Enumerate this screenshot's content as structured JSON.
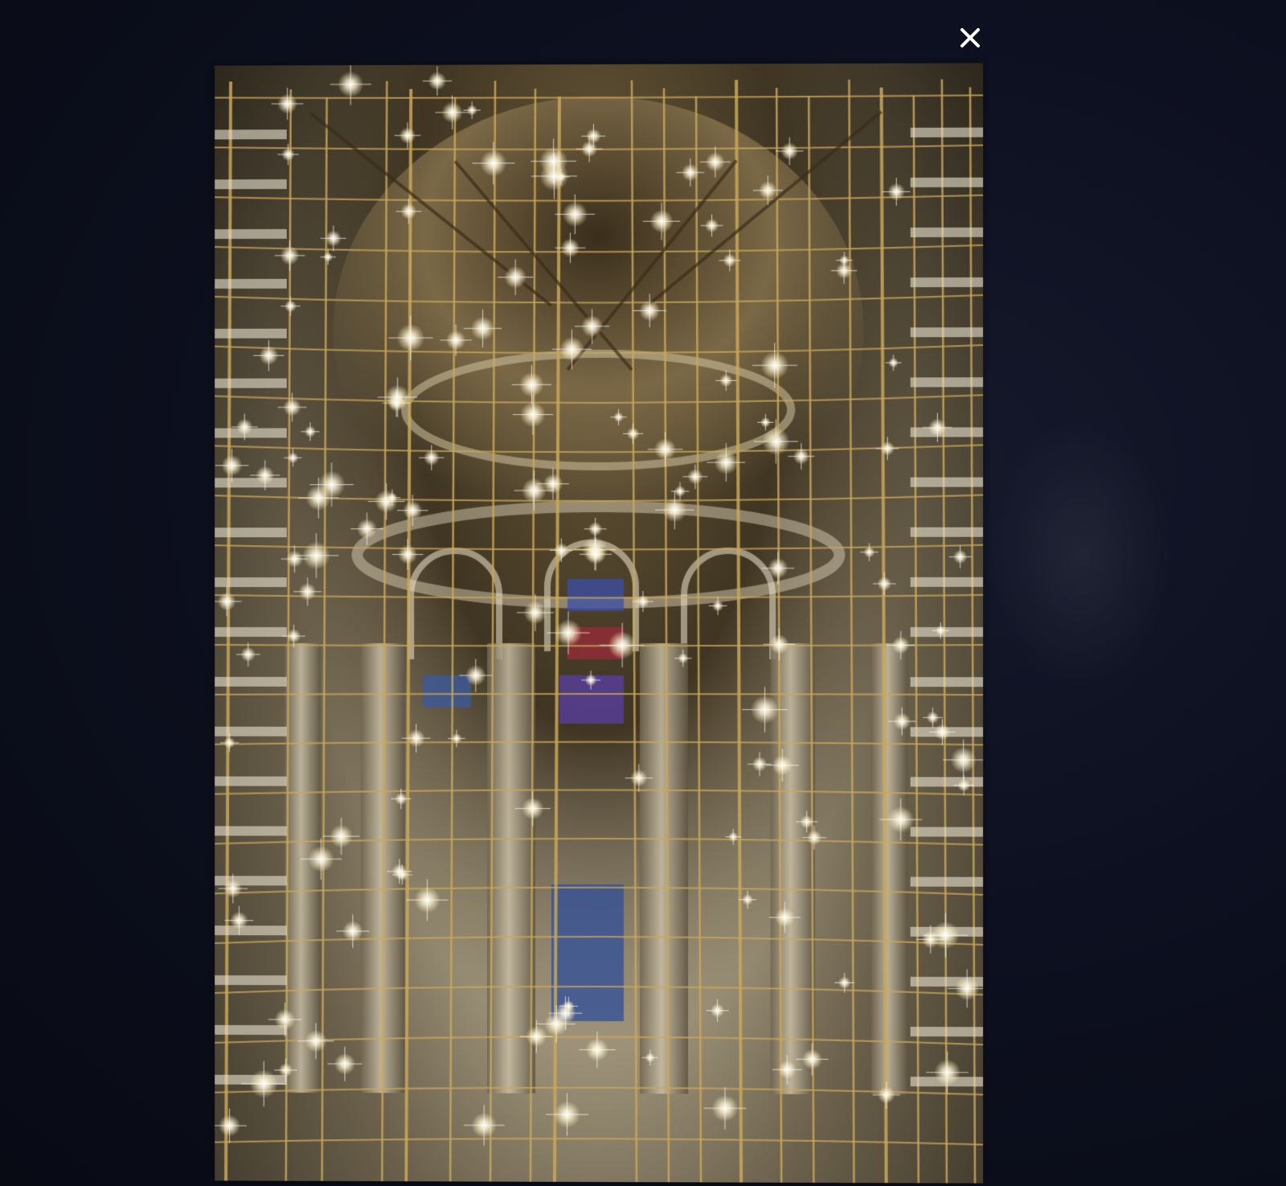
{
  "viewer": {
    "close_icon": "close-icon",
    "photo_subject": "cathedral-interior-scaffolding"
  },
  "colors": {
    "background": "#0b0d18",
    "close_icon": "#ffffff",
    "scaffold_gold": "#c9a85a",
    "stone": "#b7ad95"
  }
}
